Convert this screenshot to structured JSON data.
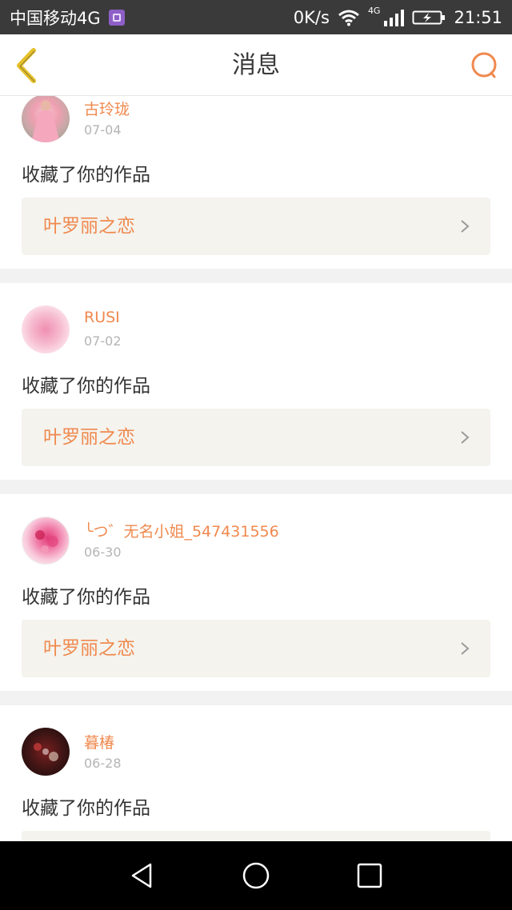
{
  "status_bar": {
    "carrier": "中国移动4G",
    "speed": "0K/s",
    "network_label": "4G",
    "time": "21:51",
    "icons": [
      "sim-icon",
      "wifi-icon",
      "signal-icon",
      "battery-charging-icon"
    ]
  },
  "nav": {
    "title": "消息",
    "back_icon": "back-chevron-icon",
    "search_icon": "search-icon"
  },
  "colors": {
    "accent": "#f0894e",
    "back_icon": "#e6c12a",
    "date": "#b4b4b4",
    "text": "#333333",
    "link_bg": "#f4f3ee",
    "page_bg": "#f2f2f2",
    "status_bar": "#3a3a3a"
  },
  "messages": [
    {
      "username": "古玲珑",
      "date": "07-04",
      "action": "收藏了你的作品",
      "work_title": "叶罗丽之恋",
      "avatar": "avatar-pink-dress"
    },
    {
      "username": "RUSI",
      "date": "07-02",
      "action": "收藏了你的作品",
      "work_title": "叶罗丽之恋",
      "avatar": "avatar-pink-blur"
    },
    {
      "username": "╰つ゛无名小姐_547431556",
      "date": "06-30",
      "action": "收藏了你的作品",
      "work_title": "叶罗丽之恋",
      "avatar": "avatar-pink-flowers"
    },
    {
      "username": "暮椿",
      "date": "06-28",
      "action": "收藏了你的作品",
      "work_title": "",
      "avatar": "avatar-dark-red"
    }
  ],
  "system_nav": [
    "back-triangle-icon",
    "home-circle-icon",
    "recents-square-icon"
  ]
}
